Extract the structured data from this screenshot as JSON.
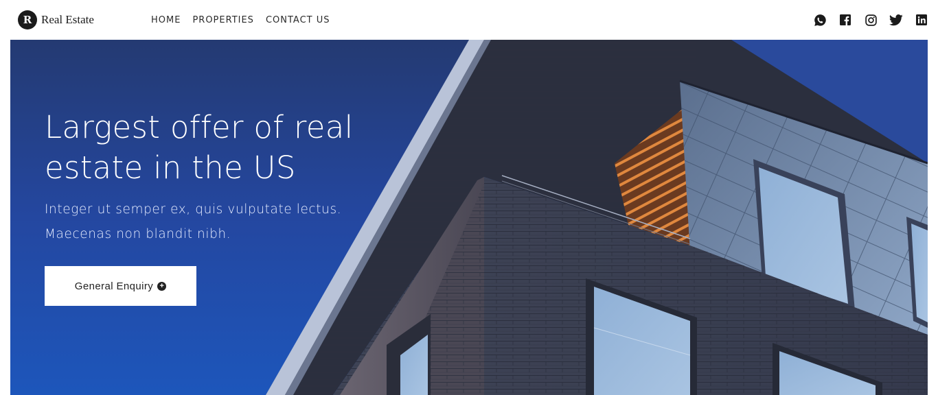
{
  "brand": {
    "logo_letter": "R",
    "name": "Real Estate"
  },
  "nav": {
    "items": [
      {
        "label": "HOME"
      },
      {
        "label": "PROPERTIES"
      },
      {
        "label": "CONTACT US"
      }
    ]
  },
  "social": {
    "icons": [
      "whatsapp-icon",
      "facebook-icon",
      "instagram-icon",
      "twitter-icon",
      "linkedin-icon"
    ]
  },
  "hero": {
    "title_line1": "Largest offer of real",
    "title_line2": "estate in the US",
    "subtitle_line1": "Integer ut semper ex, quis vulputate lectus.",
    "subtitle_line2": "Maecenas non blandit nibh.",
    "cta_label": "General Enquiry",
    "cta_icon": "plus-circle-icon"
  },
  "colors": {
    "hero_blue": "#2447a0",
    "text_dark": "#222222",
    "white": "#ffffff"
  }
}
